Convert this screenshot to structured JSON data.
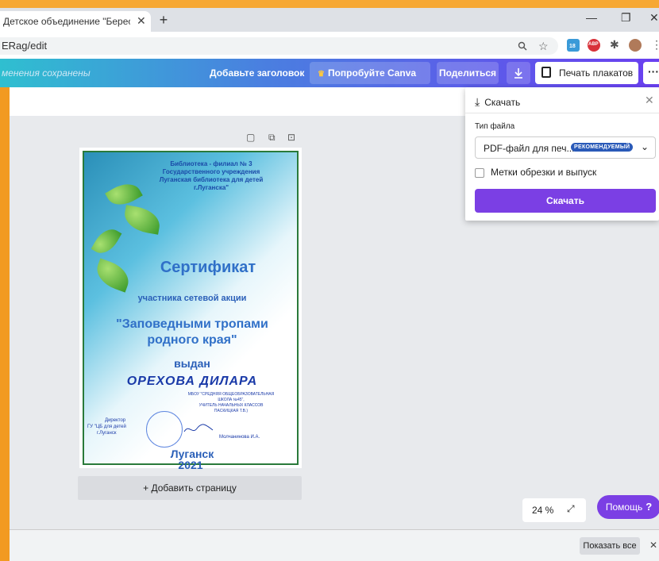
{
  "browser": {
    "tab_title": "Детское объединение \"Береста",
    "tab_close": "✕",
    "new_tab": "+",
    "url": "ERag/edit",
    "win_min": "—",
    "win_max": "❐",
    "win_close": "✕"
  },
  "extensions": {
    "badge_count": "18",
    "abp_label": "ABP"
  },
  "toolbar": {
    "saved_status": "менения сохранены",
    "add_title": "Добавьте заголовок",
    "try_pro": "Попробуйте Canva Pro",
    "share": "Поделиться",
    "print_posters": "Печать плакатов",
    "more": "···"
  },
  "download_panel": {
    "title": "Скачать",
    "file_type_label": "Тип файла",
    "selected_type": "PDF-файл для печ...",
    "recommended_badge": "РЕКОМЕНДУЕМЫЙ",
    "crop_marks_label": "Метки обрезки и выпуск",
    "download_button": "Скачать"
  },
  "certificate": {
    "org_line1": "Библиотека - филиал № 3",
    "org_line2": "Государственного учреждения",
    "org_line3": "Луганская библиотека для детей",
    "org_line4": "г.Луганска\"",
    "heading": "Сертификат",
    "subtitle": "участника сетевой акции",
    "action_line1": "\"Заповедными тропами",
    "action_line2": "родного края\"",
    "issued": "выдан",
    "recipient": "ОРЕХОВА ДИЛАРА",
    "school_line1": "МБОУ \"СРЕДНЯЯ ОБЩЕОБРАЗОВАТЕЛЬНАЯ",
    "school_line2": "ШКОЛА №45\",",
    "school_line3": "УЧИТЕЛЬ НАЧАЛЬНЫХ КЛАССОВ",
    "school_line4": "ПАСКИЦКАЯ Т.В.)",
    "director_line1": "Директор",
    "director_line2": "ГУ \"ЦБ для детей",
    "director_line3": "г.Луганск",
    "signer": "Молчанинова И.А.",
    "city": "Луганск",
    "year": "2021"
  },
  "editor": {
    "add_page": "+ Добавить страницу",
    "zoom": "24 %",
    "help": "Помощь",
    "help_mark": "?"
  },
  "download_shelf": {
    "show_all": "Показать все",
    "close": "✕"
  },
  "colors": {
    "accent_purple": "#7b3fe4",
    "badge_blue": "#2a5ab8",
    "frame_orange": "#f29a21"
  }
}
